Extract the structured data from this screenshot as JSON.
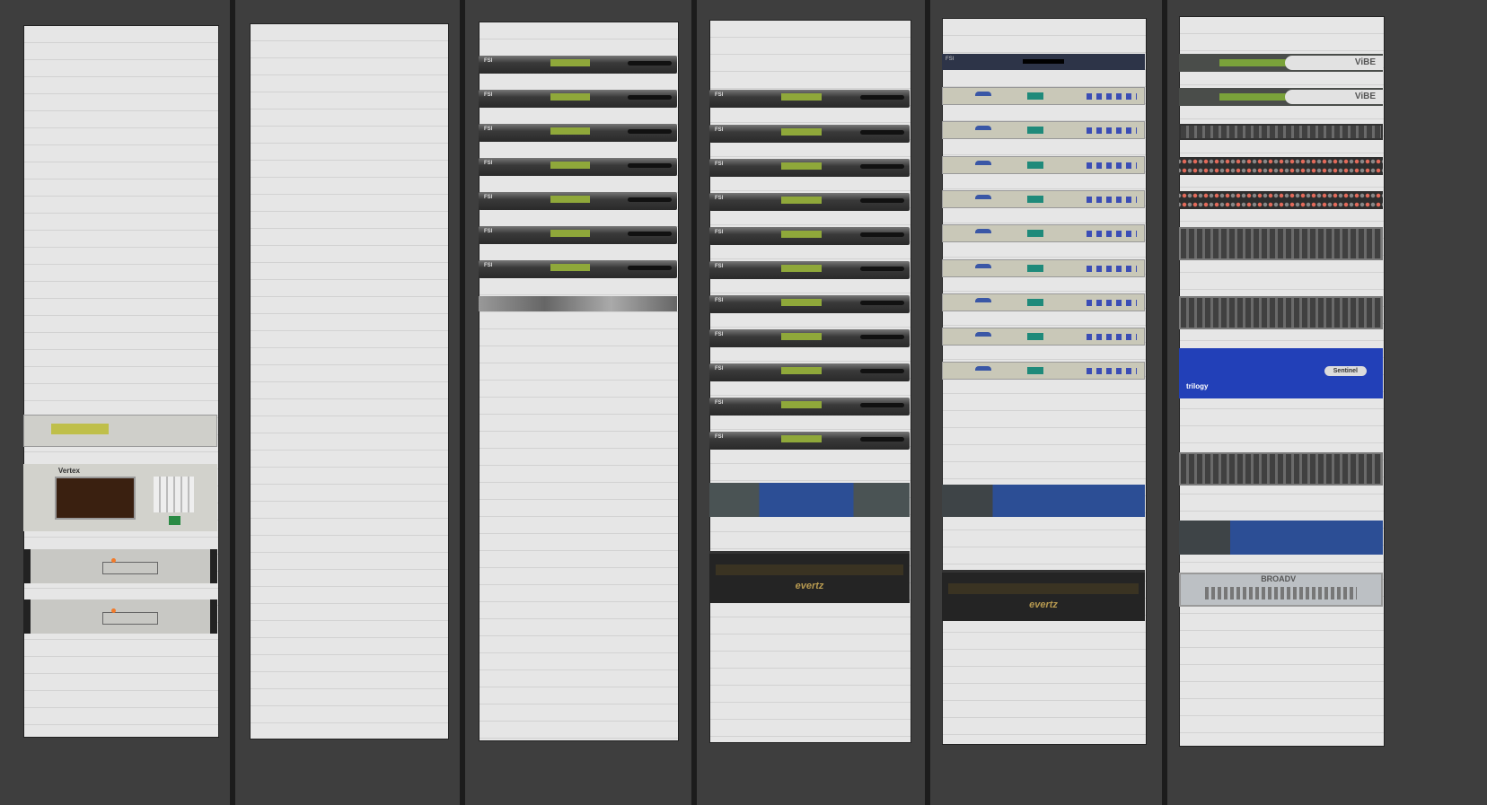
{
  "labels": {
    "fsi": "FSI",
    "vibe": "ViBE",
    "sentinel": "Sentinel",
    "trilogy": "trilogy",
    "vertex": "Vertex",
    "evertz": "evertz",
    "broadv": "BROADV"
  },
  "colors": {
    "background": "#3e3e3e",
    "rack": "#e6e6e6",
    "trilogy_blue": "#2240b8"
  }
}
